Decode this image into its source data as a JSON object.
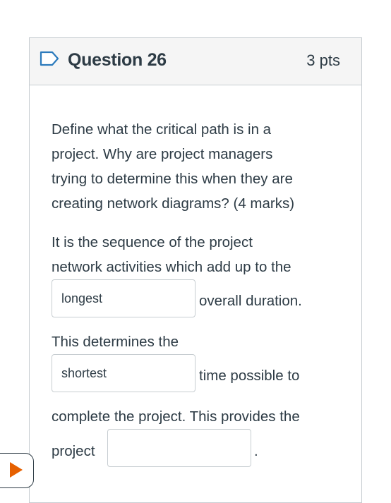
{
  "question": {
    "title": "Question 26",
    "points": "3 pts",
    "prompt_lines": [
      "Define what the critical path is in a",
      "project. Why are project managers",
      "trying to determine this when they are",
      "creating network diagrams? (4 marks)"
    ],
    "answer_lines": [
      "It is the sequence of the  project",
      "network activities which add up to the"
    ],
    "blank1": {
      "value": "longest",
      "after": "overall duration."
    },
    "line_before_blank2": "This determines the",
    "blank2": {
      "value": "shortest",
      "after": "time possible to"
    },
    "line_after_blank2": "complete the project. This provides the",
    "blank3": {
      "prefix": "project",
      "value": "",
      "after": "."
    }
  },
  "colors": {
    "accent": "#e66000",
    "border": "#c7cdd1",
    "text": "#2d3b45",
    "header_bg": "#f5f5f5"
  },
  "icons": {
    "flag": "bookmark-flag-icon",
    "nav": "play-arrow-icon"
  }
}
